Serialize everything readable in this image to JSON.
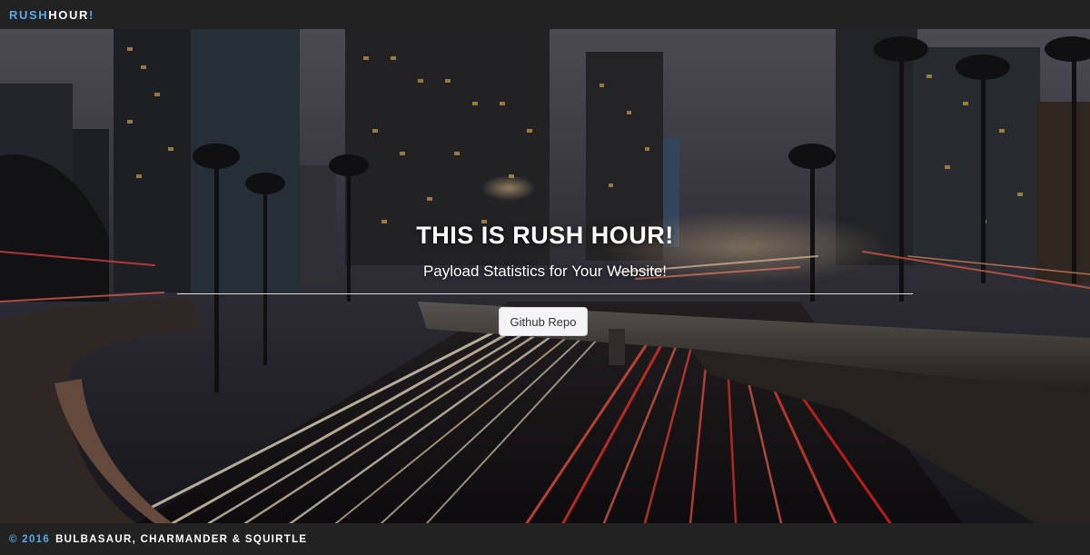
{
  "navbar": {
    "brand_part1": "RUSH",
    "brand_part2": "HOUR",
    "brand_part3": "!"
  },
  "hero": {
    "title": "THIS IS RUSH HOUR!",
    "subtitle": "Payload Statistics for Your Website!",
    "button_label": "Github Repo",
    "background_image": "city-highway-night-long-exposure"
  },
  "footer": {
    "copyright_year": "© 2016",
    "credits": "BULBASAUR, CHARMANDER & SQUIRTLE"
  },
  "colors": {
    "accent": "#5aa8e8",
    "bar_bg": "#222222",
    "button_bg": "#f4f4f6"
  }
}
